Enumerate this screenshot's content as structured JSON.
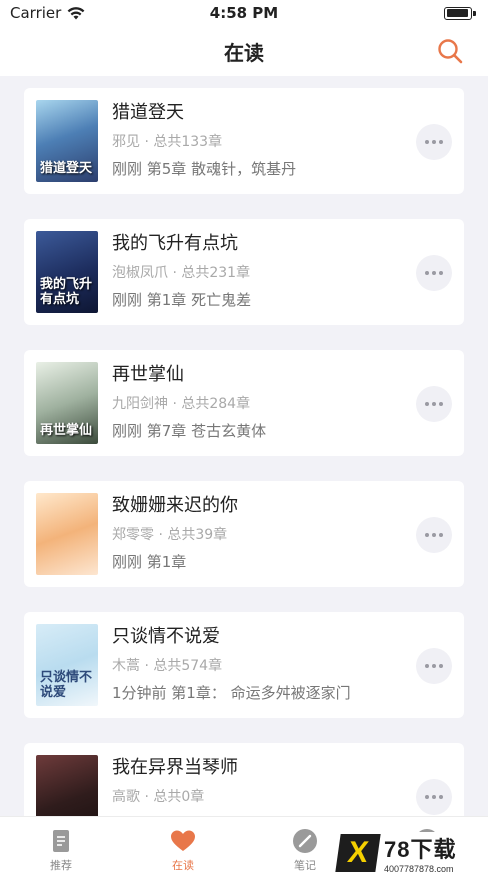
{
  "status_bar": {
    "carrier": "Carrier",
    "time": "4:58 PM"
  },
  "nav": {
    "title": "在读"
  },
  "colors": {
    "accent": "#e8774a",
    "background": "#f2f2f7"
  },
  "books": [
    {
      "title": "猎道登天",
      "meta": "邪见 · 总共133章",
      "progress": "刚刚 第5章 散魂针，筑基丹",
      "cover_text": "猎道登天"
    },
    {
      "title": "我的飞升有点坑",
      "meta": "泡椒凤爪 · 总共231章",
      "progress": "刚刚 第1章 死亡鬼差",
      "cover_text": "我的飞升有点坑"
    },
    {
      "title": "再世掌仙",
      "meta": "九阳剑神 · 总共284章",
      "progress": "刚刚 第7章 苍古玄黄体",
      "cover_text": "再世掌仙"
    },
    {
      "title": "致姗姗来迟的你",
      "meta": "郑零零 · 总共39章",
      "progress": "刚刚 第1章",
      "cover_text": ""
    },
    {
      "title": "只谈情不说爱",
      "meta": "木蒿 · 总共574章",
      "progress": "1分钟前 第1章： 命运多舛被逐家门",
      "cover_text": "只谈情不说爱"
    },
    {
      "title": "我在异界当琴师",
      "meta": "高歌 · 总共0章",
      "progress": "",
      "cover_text": ""
    }
  ],
  "tabs": [
    {
      "label": "推荐",
      "icon": "document-icon",
      "active": false
    },
    {
      "label": "在读",
      "icon": "heart-icon",
      "active": true
    },
    {
      "label": "笔记",
      "icon": "pen-icon",
      "active": false
    },
    {
      "label": "",
      "icon": "profile-icon",
      "active": false
    }
  ],
  "watermark": {
    "logo_letter": "X",
    "text": "78下载",
    "url": "4007787878.com"
  }
}
